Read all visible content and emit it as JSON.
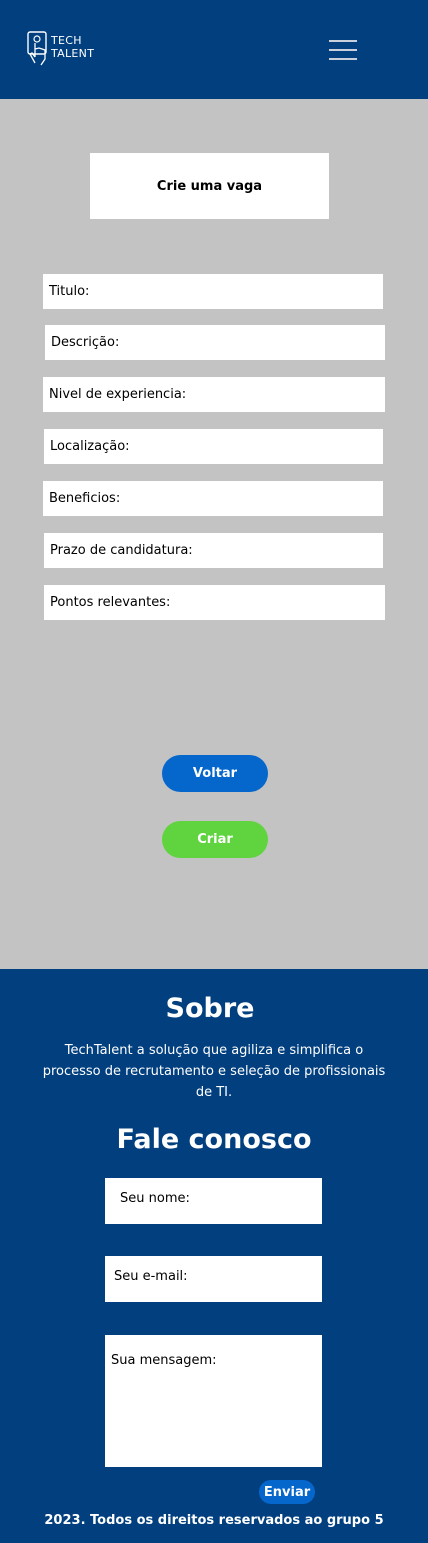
{
  "header": {
    "logo_line1": "TECH",
    "logo_line2": "TALENT",
    "menu_icon": "hamburger-menu-icon"
  },
  "form": {
    "title": "Crie uma vaga",
    "fields": [
      "Titulo:",
      "Descrição:",
      "Nivel de experiencia:",
      "Localização:",
      "Beneficios:",
      "Prazo de candidatura:",
      "Pontos relevantes:"
    ],
    "back_label": "Voltar",
    "create_label": "Criar"
  },
  "footer": {
    "about_title": "Sobre",
    "about_text": "TechTalent a solução que agiliza e simplifica o processo de recrutamento e seleção de profissionais de TI.",
    "contact_title": "Fale conosco",
    "name_placeholder": "Seu nome:",
    "email_placeholder": "Seu e-mail:",
    "message_placeholder": "Sua mensagem:",
    "send_label": "Enviar",
    "copyright": "2023. Todos os direitos reservados ao grupo 5"
  },
  "colors": {
    "header_bg": "#013f7f",
    "page_bg": "#c3c3c3",
    "primary_button": "#0566cc",
    "create_button": "#5fd43f"
  }
}
